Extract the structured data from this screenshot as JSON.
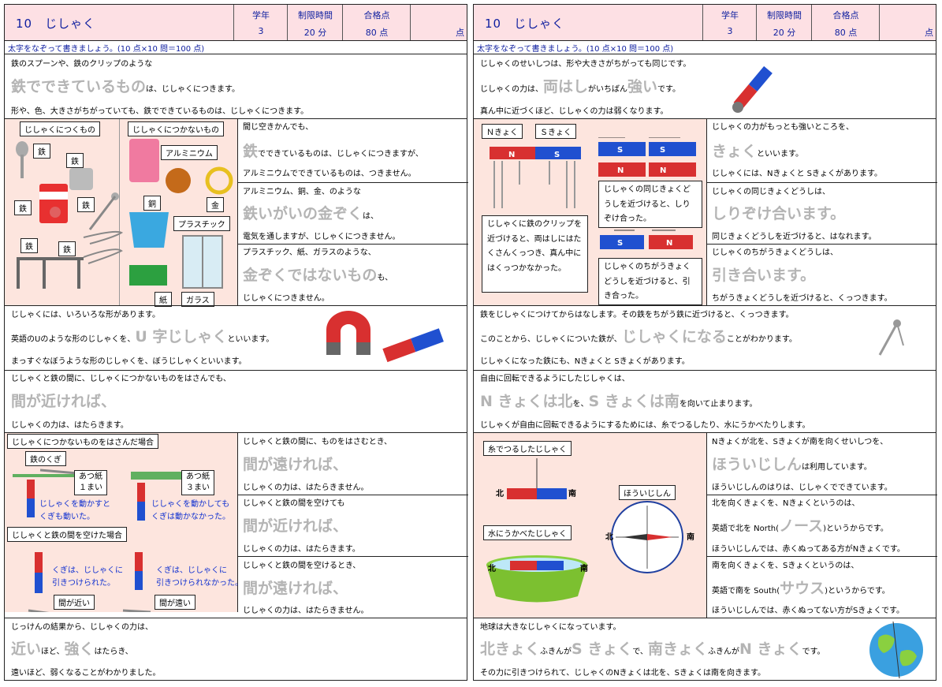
{
  "header": {
    "number": "10",
    "title": "じしゃく",
    "grade_label": "学年",
    "grade": "3",
    "time_label": "制限時間",
    "time": "20 分",
    "pass_label": "合格点",
    "pass": "80 点",
    "score_unit": "点"
  },
  "instruction": "太字をなぞって書きましょう。(10 点×10 問＝100 点)",
  "left": {
    "s1": {
      "l1": "鉄のスプーンや、鉄のクリップのような",
      "big": "鉄でできているもの",
      "after": "は、じしゃくにつきます。",
      "l3": "形や、色、大きさがちがっていても、鉄でできているものは、じしゃくにつきます。"
    },
    "s2": {
      "cap_a": "じしゃくにつくもの",
      "cap_b": "じしゃくにつかないもの",
      "tags": {
        "iron": "鉄",
        "aluminum": "アルミニウム",
        "copper": "銅",
        "gold": "金",
        "plastic": "プラスチック",
        "paper": "紙",
        "glass": "ガラス"
      },
      "a1": "間じ空きかんでも、",
      "a2": "鉄",
      "a2b": "でできているものは、じしゃくにつきますが、",
      "a3": "アルミニウムでできているものは、つきません。",
      "b1": "アルミニウム、銅、金、のような",
      "b2": "鉄いがいの金ぞく",
      "b2b": "は、",
      "b3": "電気を通しますが、じしゃくにつきません。",
      "c1": "プラスチック、紙、ガラスのような、",
      "c2": "金ぞくではないもの",
      "c2b": "も、",
      "c3": "じしゃくにつきません。"
    },
    "s3": {
      "l1": "じしゃくには、いろいろな形があります。",
      "l2a": "英語のUのような形のじしゃくを、",
      "l2big": "U 字じしゃく",
      "l2b": "といいます。",
      "l3": "まっすぐなぼうような形のじしゃくを、ぼうじしゃくといいます。"
    },
    "s4": {
      "l1": "じしゃくと鉄の間に、じしゃくにつかないものをはさんでも、",
      "big": "間が近ければ、",
      "l3": "じしゃくの力は、はたらきます。"
    },
    "s5": {
      "cap1": "じしゃくにつかないものをはさんだ場合",
      "nail": "鉄のくぎ",
      "paper1": "あつ紙",
      "paper1b": "１まい",
      "paper3": "あつ紙",
      "paper3b": "３まい",
      "n1": "じしゃくを動かすと",
      "n2": "くぎも動いた。",
      "n3": "じしゃくを動かしても",
      "n4": "くぎは動かなかった。",
      "cap2": "じしゃくと鉄の間を空けた場合",
      "m1": "くぎは、じしゃくに",
      "m2": "引きつけられた。",
      "m3": "くぎは、じしゃくに",
      "m4": "引きつけられなかった。",
      "near": "間が近い",
      "far": "間が遠い",
      "r1a": "じしゃくと鉄の間に、ものをはさむとき、",
      "r1b": "間が遠ければ、",
      "r1c": "じしゃくの力は、はたらきません。",
      "r2a": "じしゃくと鉄の間を空けても",
      "r2b": "間が近ければ、",
      "r2c": "じしゃくの力は、はたらきます。",
      "r3a": "じしゃくと鉄の間を空けるとき、",
      "r3b": "間が遠ければ、",
      "r3c": "じしゃくの力は、はたらきません。"
    },
    "s6": {
      "l1": "じっけんの結果から、じしゃくの力は、",
      "b1": "近い",
      "t1": "ほど、",
      "b2": "強く",
      "t2": "はたらき、",
      "l3": "遠いほど、弱くなることがわかりました。"
    }
  },
  "right": {
    "s1": {
      "l1": "じしゃくのせいしつは、形や大きさがちがっても同じです。",
      "l2a": "じしゃくの力は、",
      "l2big": "両はし",
      "l2b": "がいちばん",
      "l2big2": "強い",
      "l2c": "です。",
      "l3": "真ん中に近づくほど、じしゃくの力は弱くなります。"
    },
    "s2": {
      "nlab": "Ｎきょく",
      "slab": "Ｓきょく",
      "N": "N",
      "S": "S",
      "box1": "じしゃくに鉄のクリップを近づけると、両はしにはたくさんくっつき、真ん中にはくっつかなかった。",
      "box2": "じしゃくの同じきょくどうしを近づけると、しりぞけ合った。",
      "box3": "じしゃくのちがうきょくどうしを近づけると、引き合った。",
      "a1": "じしゃくの力がもっとも強いところを、",
      "a2": "きょく",
      "a2b": "といいます。",
      "a3": "じしゃくには、Nきょくと Sきょくがあります。",
      "b1": "じしゃくの同じきょくどうしは、",
      "b2": "しりぞけ合います。",
      "b3": "同じきょくどうしを近づけると、はなれます。",
      "c1": "じしゃくのちがうきょくどうしは、",
      "c2": "引き合います。",
      "c3": "ちがうきょくどうしを近づけると、くっつきます。"
    },
    "s3": {
      "l1": "鉄をじしゃくにつけてからはなします。その鉄をちがう鉄に近づけると、くっつきます。",
      "l2a": "このことから、じしゃくについた鉄が、",
      "l2big": "じしゃくになる",
      "l2b": "ことがわかります。",
      "l3": "じしゃくになった鉄にも、Nきょくと Sきょくがあります。"
    },
    "s4": {
      "l1": "自由に回転できるようにしたじしゃくは、",
      "b1": "N きょくは北",
      "t1": "を、",
      "b2": "S きょくは南",
      "t2": "を向いて止まります。",
      "l3": "じしゃくが自由に回転できるようにするためには、糸でつるしたり、水にうかべたりします。"
    },
    "s5": {
      "cap1": "糸でつるしたじしゃく",
      "cap2": "水にうかべたじしゃく",
      "cap3": "ほういじしん",
      "north": "北",
      "south": "南",
      "a1": "Nきょくが北を、Sきょくが南を向くせいしつを、",
      "a2": "ほういじしん",
      "a2b": "は利用しています。",
      "a3": "ほういじしんのはりは、じしゃくでできています。",
      "b1": "北を向くきょくを、Nきょくというのは、",
      "b2a": "英語で北を North(",
      "b2big": "ノース",
      "b2b": ")というからです。",
      "b3": "ほういじしんでは、赤くぬってある方がNきょくです。",
      "c1": "南を向くきょくを、Sきょくというのは、",
      "c2a": "英語で南を South(",
      "c2big": "サウス",
      "c2b": ")というからです。",
      "c3": "ほういじしんでは、赤くぬってない方がSきょくです。"
    },
    "s6": {
      "l1": "地球は大きなじしゃくになっています。",
      "b1": "北きょく",
      "t1": "ふきんが",
      "b2": "S きょく",
      "t2": "で、",
      "b3": "南きょく",
      "t3": "ふきんが",
      "b4": "N きょく",
      "t4": "です。",
      "l3": "その力に引きつけられて、じしゃくのNきょくは北を、Sきょくは南を向きます。"
    }
  },
  "colors": {
    "header_bg": "#fde0e4",
    "title_blue": "#1020a0",
    "trace_gray": "#b4b4b4",
    "pink_panel": "#fde5de",
    "magnet_red": "#e02020",
    "magnet_blue": "#2050d0"
  }
}
